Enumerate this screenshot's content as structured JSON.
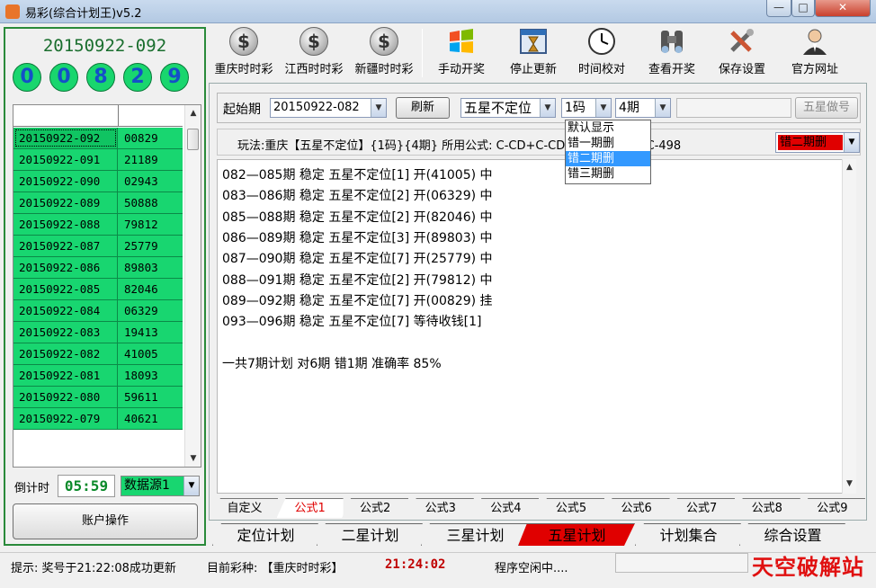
{
  "window": {
    "title": "易彩(综合计划王)v5.2",
    "minimize": "—",
    "maximize": "□",
    "close": "✕"
  },
  "toolbar": [
    {
      "label": "重庆时时彩",
      "icon": "dollar-coin-icon"
    },
    {
      "label": "江西时时彩",
      "icon": "dollar-coin-icon"
    },
    {
      "label": "新疆时时彩",
      "icon": "dollar-coin-icon"
    },
    {
      "label": "手动开奖",
      "icon": "windows-flag-icon"
    },
    {
      "label": "停止更新",
      "icon": "hourglass-window-icon"
    },
    {
      "label": "时间校对",
      "icon": "clock-icon"
    },
    {
      "label": "查看开奖",
      "icon": "binoculars-icon"
    },
    {
      "label": "保存设置",
      "icon": "tools-icon"
    },
    {
      "label": "官方网址",
      "icon": "user-icon"
    }
  ],
  "latest": {
    "period": "20150922-092",
    "numbers": [
      "0",
      "0",
      "8",
      "2",
      "9"
    ]
  },
  "history": [
    {
      "period": "20150922-092",
      "number": "00829"
    },
    {
      "period": "20150922-091",
      "number": "21189"
    },
    {
      "period": "20150922-090",
      "number": "02943"
    },
    {
      "period": "20150922-089",
      "number": "50888"
    },
    {
      "period": "20150922-088",
      "number": "79812"
    },
    {
      "period": "20150922-087",
      "number": "25779"
    },
    {
      "period": "20150922-086",
      "number": "89803"
    },
    {
      "period": "20150922-085",
      "number": "82046"
    },
    {
      "period": "20150922-084",
      "number": "06329"
    },
    {
      "period": "20150922-083",
      "number": "19413"
    },
    {
      "period": "20150922-082",
      "number": "41005"
    },
    {
      "period": "20150922-081",
      "number": "18093"
    },
    {
      "period": "20150922-080",
      "number": "59611"
    },
    {
      "period": "20150922-079",
      "number": "40621"
    }
  ],
  "countdown": {
    "label": "倒计时",
    "value": "05:59"
  },
  "source": {
    "value": "数据源1"
  },
  "account_button": "账户操作",
  "filter": {
    "start_label": "起始期",
    "start_value": "20150922-082",
    "refresh": "刷新",
    "play_value": "五星不定位",
    "code_value": "1码",
    "periods_value": "4期",
    "extra_value": "",
    "fivestar_button": "五星做号"
  },
  "info": {
    "text": "玩法:重庆【五星不定位】{1码}{4期} 所用公式: C-CD+C-CDC-C-CD+C-CDC-498",
    "mode_value": "错二期删"
  },
  "mode_options": [
    "默认显示",
    "错一期删",
    "错二期删",
    "错三期删"
  ],
  "results": [
    "082—085期 稳定 五星不定位[1] 开(41005) 中",
    "083—086期 稳定 五星不定位[2] 开(06329) 中",
    "085—088期 稳定 五星不定位[2] 开(82046) 中",
    "086—089期 稳定 五星不定位[3] 开(89803) 中",
    "087—090期 稳定 五星不定位[7] 开(25779) 中",
    "088—091期 稳定 五星不定位[2] 开(79812) 中",
    "089—092期 稳定 五星不定位[7] 开(00829) 挂",
    "093—096期 稳定 五星不定位[7] 等待收钱[1]",
    "",
    "一共7期计划 对6期 错1期 准确率 85%"
  ],
  "formula_tabs": [
    "自定义",
    "公式1",
    "公式2",
    "公式3",
    "公式4",
    "公式5",
    "公式6",
    "公式7",
    "公式8",
    "公式9"
  ],
  "formula_active": "公式1",
  "plan_tabs": [
    "定位计划",
    "二星计划",
    "三星计划",
    "五星计划",
    "计划集合",
    "综合设置"
  ],
  "plan_active": "五星计划",
  "status": {
    "hint": "提示: 奖号于21:22:08成功更新",
    "lottery": "目前彩种: 【重庆时时彩】",
    "time": "21:24:02",
    "program": "程序空闲中....",
    "watermark": "天空破解站"
  },
  "colors": {
    "accent_green": "#18d670",
    "active_red": "#e00000",
    "ball_blue": "#1450c8"
  }
}
